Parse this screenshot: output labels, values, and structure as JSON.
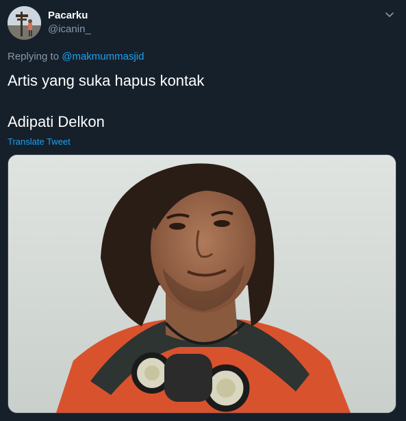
{
  "author": {
    "display_name": "Pacarku",
    "handle": "@icanin_"
  },
  "reply": {
    "prefix": "Replying to ",
    "mention": "@makmummasjid"
  },
  "tweet": {
    "line1": "Artis yang suka hapus kontak",
    "line2": "Adipati Delkon"
  },
  "translate_label": "Translate Tweet",
  "icons": {
    "caret": "chevron-down-icon"
  },
  "colors": {
    "background": "#15202b",
    "text": "#ffffff",
    "secondary_text": "#8899a6",
    "link": "#1da1f2",
    "border": "#38444d"
  }
}
